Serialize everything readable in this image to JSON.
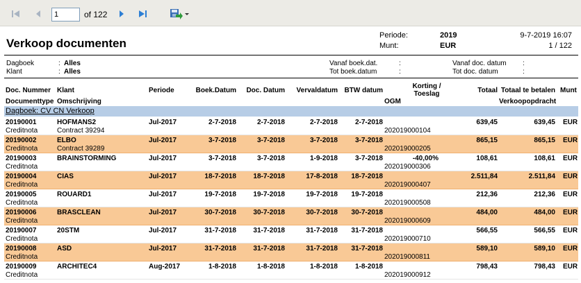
{
  "toolbar": {
    "page_value": "1",
    "page_of": "of 122"
  },
  "report": {
    "title": "Verkoop documenten",
    "periode_label": "Periode:",
    "periode_value": "2019",
    "munt_label": "Munt:",
    "munt_value": "EUR",
    "datetime": "9-7-2019 16:07",
    "page_count": "1 / 122",
    "filters": {
      "dagboek_label": "Dagboek",
      "dagboek_value": "Alles",
      "klant_label": "Klant",
      "klant_value": "Alles",
      "vanaf_boek_label": "Vanaf boek.dat.",
      "tot_boek_label": "Tot boek.datum",
      "vanaf_doc_label": "Vanaf doc. datum",
      "tot_doc_label": "Tot doc. datum"
    },
    "columns": {
      "doc_nummer": "Doc. Nummer",
      "klant": "Klant",
      "periode": "Periode",
      "boek_datum": "Boek.Datum",
      "doc_datum": "Doc. Datum",
      "vervaldatum": "Vervaldatum",
      "btw_datum": "BTW datum",
      "korting": "Korting /",
      "toeslag": "Toeslag",
      "totaal": "Totaal",
      "totaal_betalen": "Totaal te betalen",
      "munt": "Munt",
      "documenttype": "Documenttype",
      "omschrijving": "Omschrijving",
      "ogm": "OGM",
      "verkoopopdracht": "Verkoopopdracht"
    },
    "group_label": "Dagboek: CV CN Verkoop",
    "rows": [
      {
        "nr": "20190001",
        "klant": "HOFMANS2",
        "periode": "Jul-2017",
        "boek": "2-7-2018",
        "doc": "2-7-2018",
        "verval": "2-7-2018",
        "btw": "2-7-2018",
        "korting": "",
        "totaal": "639,45",
        "betalen": "639,45",
        "munt": "EUR",
        "type": "Creditnota",
        "omschr": "Contract 39294",
        "ogm": "202019000104"
      },
      {
        "nr": "20190002",
        "klant": "ELBO",
        "periode": "Jul-2017",
        "boek": "3-7-2018",
        "doc": "3-7-2018",
        "verval": "3-7-2018",
        "btw": "3-7-2018",
        "korting": "",
        "totaal": "865,15",
        "betalen": "865,15",
        "munt": "EUR",
        "type": "Creditnota",
        "omschr": "Contract 39289",
        "ogm": "202019000205"
      },
      {
        "nr": "20190003",
        "klant": "BRAINSTORMING",
        "periode": "Jul-2017",
        "boek": "3-7-2018",
        "doc": "3-7-2018",
        "verval": "1-9-2018",
        "btw": "3-7-2018",
        "korting": "-40,00%",
        "totaal": "108,61",
        "betalen": "108,61",
        "munt": "EUR",
        "type": "Creditnota",
        "omschr": "",
        "ogm": "202019000306"
      },
      {
        "nr": "20190004",
        "klant": "CIAS",
        "periode": "Jul-2017",
        "boek": "18-7-2018",
        "doc": "18-7-2018",
        "verval": "17-8-2018",
        "btw": "18-7-2018",
        "korting": "",
        "totaal": "2.511,84",
        "betalen": "2.511,84",
        "munt": "EUR",
        "type": "Creditnota",
        "omschr": "",
        "ogm": "202019000407"
      },
      {
        "nr": "20190005",
        "klant": "ROUARD1",
        "periode": "Jul-2017",
        "boek": "19-7-2018",
        "doc": "19-7-2018",
        "verval": "19-7-2018",
        "btw": "19-7-2018",
        "korting": "",
        "totaal": "212,36",
        "betalen": "212,36",
        "munt": "EUR",
        "type": "Creditnota",
        "omschr": "",
        "ogm": "202019000508"
      },
      {
        "nr": "20190006",
        "klant": "BRASCLEAN",
        "periode": "Jul-2017",
        "boek": "30-7-2018",
        "doc": "30-7-2018",
        "verval": "30-7-2018",
        "btw": "30-7-2018",
        "korting": "",
        "totaal": "484,00",
        "betalen": "484,00",
        "munt": "EUR",
        "type": "Creditnota",
        "omschr": "",
        "ogm": "202019000609"
      },
      {
        "nr": "20190007",
        "klant": "20STM",
        "periode": "Jul-2017",
        "boek": "31-7-2018",
        "doc": "31-7-2018",
        "verval": "31-7-2018",
        "btw": "31-7-2018",
        "korting": "",
        "totaal": "566,55",
        "betalen": "566,55",
        "munt": "EUR",
        "type": "Creditnota",
        "omschr": "",
        "ogm": "202019000710"
      },
      {
        "nr": "20190008",
        "klant": "ASD",
        "periode": "Jul-2017",
        "boek": "31-7-2018",
        "doc": "31-7-2018",
        "verval": "31-7-2018",
        "btw": "31-7-2018",
        "korting": "",
        "totaal": "589,10",
        "betalen": "589,10",
        "munt": "EUR",
        "type": "Creditnota",
        "omschr": "",
        "ogm": "202019000811"
      },
      {
        "nr": "20190009",
        "klant": "ARCHITEC4",
        "periode": "Aug-2017",
        "boek": "1-8-2018",
        "doc": "1-8-2018",
        "verval": "1-8-2018",
        "btw": "1-8-2018",
        "korting": "",
        "totaal": "798,43",
        "betalen": "798,43",
        "munt": "EUR",
        "type": "Creditnota",
        "omschr": "",
        "ogm": "202019000912"
      }
    ]
  }
}
